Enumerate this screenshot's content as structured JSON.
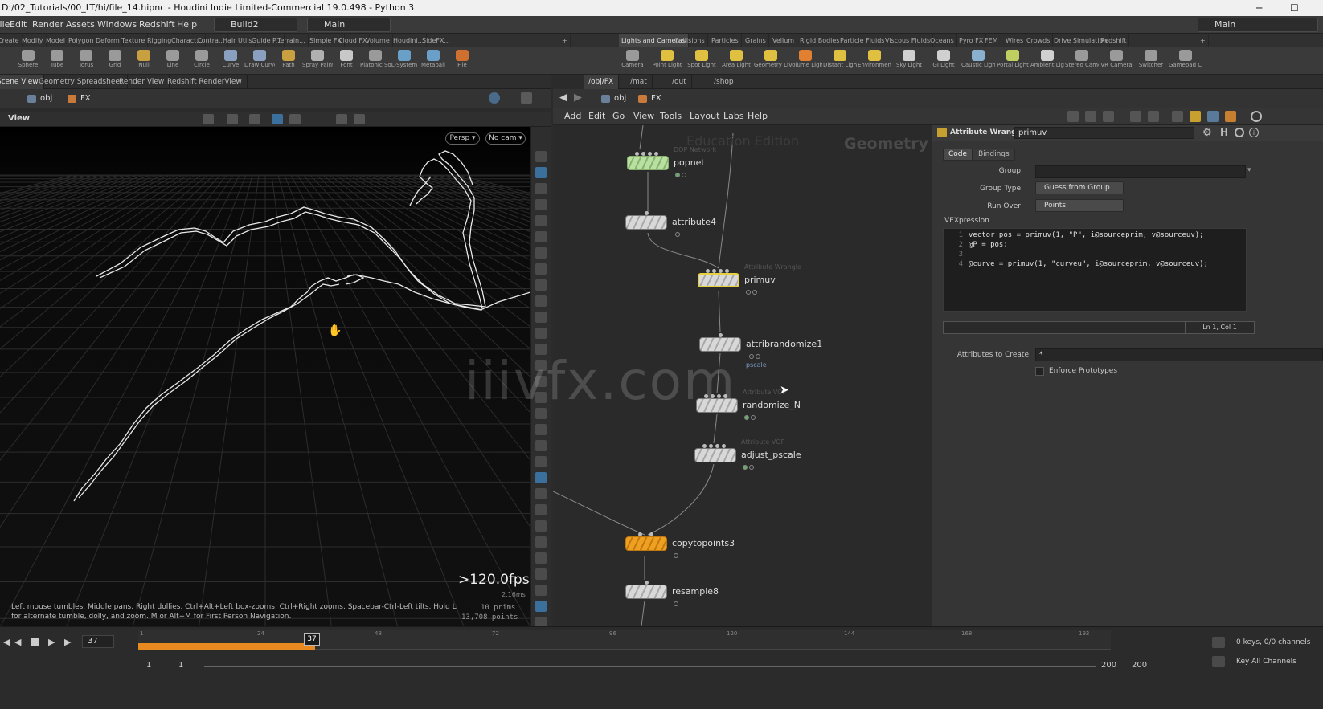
{
  "window": {
    "title": "D:/02_Tutorials/00_LT/hi/file_14.hipnc - Houdini Indie Limited-Commercial 19.0.498 - Python 3",
    "min": "─",
    "max": "☐"
  },
  "menubar": {
    "items": [
      "File",
      "Edit",
      "Render",
      "Assets",
      "Windows",
      "Redshift",
      "Help"
    ],
    "desktop1": "Build2",
    "desktop2": "Main",
    "right_desktop": "Main"
  },
  "shelf_tabs_left": [
    "Create",
    "Modify",
    "Model",
    "Polygon",
    "Deform",
    "Texture",
    "Rigging",
    "Charact...",
    "Contra...",
    "Hair Utils",
    "Guide P...",
    "Terrain...",
    "Simple FX",
    "Cloud FX",
    "Volume",
    "Houdini...",
    "SideFX..."
  ],
  "shelf_tabs_right": [
    "Lights and Cameras",
    "Collisions",
    "Particles",
    "Grains",
    "Vellum",
    "Rigid Bodies",
    "Particle Fluids",
    "Viscous Fluids",
    "Oceans",
    "Pyro FX",
    "FEM",
    "Wires",
    "Crowds",
    "Drive Simulation",
    "Redshift"
  ],
  "tools_left": [
    {
      "label": "Sphere",
      "color": "#9a9a9a"
    },
    {
      "label": "Tube",
      "color": "#9a9a9a"
    },
    {
      "label": "Torus",
      "color": "#9a9a9a"
    },
    {
      "label": "Grid",
      "color": "#9a9a9a"
    },
    {
      "label": "Null",
      "color": "#c8a040"
    },
    {
      "label": "Line",
      "color": "#9a9a9a"
    },
    {
      "label": "Circle",
      "color": "#9a9a9a"
    },
    {
      "label": "Curve",
      "color": "#8aa0c0"
    },
    {
      "label": "Draw Curve",
      "color": "#8aa0c0"
    },
    {
      "label": "Path",
      "color": "#c8a040"
    },
    {
      "label": "Spray Paint",
      "color": "#b0b0b0"
    },
    {
      "label": "Font",
      "color": "#c8c8c8"
    },
    {
      "label": "Platonic Solids",
      "color": "#9a9a9a"
    },
    {
      "label": "L-System",
      "color": "#6aa0c8"
    },
    {
      "label": "Metaball",
      "color": "#6aa0c8"
    },
    {
      "label": "File",
      "color": "#d07030"
    }
  ],
  "tools_right": [
    {
      "label": "Camera",
      "color": "#9a9a9a"
    },
    {
      "label": "Point Light",
      "color": "#e0c040"
    },
    {
      "label": "Spot Light",
      "color": "#e0c040"
    },
    {
      "label": "Area Light",
      "color": "#e0c040"
    },
    {
      "label": "Geometry Light",
      "color": "#e0c040"
    },
    {
      "label": "Volume Light",
      "color": "#e08030"
    },
    {
      "label": "Distant Light",
      "color": "#e0c040"
    },
    {
      "label": "Environment Light",
      "color": "#e0c040"
    },
    {
      "label": "Sky Light",
      "color": "#d0d0d0"
    },
    {
      "label": "GI Light",
      "color": "#d0d0d0"
    },
    {
      "label": "Caustic Light",
      "color": "#8ab0d0"
    },
    {
      "label": "Portal Light",
      "color": "#c0d060"
    },
    {
      "label": "Ambient Light",
      "color": "#d0d0d0"
    },
    {
      "label": "Stereo Camera",
      "color": "#9a9a9a"
    },
    {
      "label": "VR Camera",
      "color": "#9a9a9a"
    },
    {
      "label": "Switcher",
      "color": "#9a9a9a"
    },
    {
      "label": "Gamepad Camera",
      "color": "#9a9a9a"
    }
  ],
  "left_pane": {
    "tabs": [
      "Scene View",
      "Geometry Spreadsheet",
      "Render View",
      "Redshift RenderView"
    ],
    "path": [
      "obj",
      "FX"
    ],
    "view_label": "View",
    "persp": "Persp ▾",
    "cam": "No cam ▾",
    "fps": ">120.0fps",
    "ms": "2.16ms",
    "prims": "10  prims",
    "points": "13,708 points",
    "help": "Left mouse tumbles. Middle pans. Right dollies. Ctrl+Alt+Left box-zooms. Ctrl+Right zooms. Spacebar-Ctrl-Left tilts. Hold L for alternate tumble, dolly, and zoom.    M or Alt+M for First Person Navigation."
  },
  "right_pane": {
    "tabs": [
      "/obj/FX",
      "/mat",
      "/out",
      "/shop"
    ],
    "path": [
      "obj",
      "FX"
    ],
    "menu": [
      "Add",
      "Edit",
      "Go",
      "View",
      "Tools",
      "Layout",
      "Labs",
      "Help"
    ],
    "edition": "Education Edition",
    "context": "Geometry"
  },
  "nodes": [
    {
      "name": "popnet",
      "type": "DOP Network",
      "tag": ""
    },
    {
      "name": "attribute4",
      "type": "",
      "tag": ""
    },
    {
      "name": "primuv",
      "type": "Attribute Wrangle",
      "tag": ""
    },
    {
      "name": "attribrandomize1",
      "type": "",
      "tag": "pscale"
    },
    {
      "name": "randomize_N",
      "type": "Attribute VOP",
      "tag": ""
    },
    {
      "name": "adjust_pscale",
      "type": "Attribute VOP",
      "tag": ""
    },
    {
      "name": "copytopoints3",
      "type": "",
      "tag": ""
    },
    {
      "name": "resample8",
      "type": "",
      "tag": ""
    }
  ],
  "params": {
    "node_type": "Attribute Wrangle",
    "node_name": "primuv",
    "tabs": [
      "Code",
      "Bindings"
    ],
    "group_label": "Group",
    "group_value": "",
    "group_type_label": "Group Type",
    "group_type_value": "Guess from Group",
    "run_over_label": "Run Over",
    "run_over_value": "Points",
    "vex_label": "VEXpression",
    "code": [
      "vector pos = primuv(1, \"P\", i@sourceprim, v@sourceuv);",
      "@P = pos;",
      "",
      "@curve = primuv(1, \"curveu\", i@sourceprim, v@sourceuv);"
    ],
    "cursor": "Ln 1, Col 1",
    "attrs_label": "Attributes to Create",
    "attrs_value": "*",
    "enforce_label": "Enforce Prototypes"
  },
  "timeline": {
    "frame": "37",
    "ticks": [
      "1",
      "24",
      "48",
      "72",
      "96",
      "120",
      "144",
      "168",
      "192"
    ],
    "current": "37",
    "start": "1",
    "start2": "1",
    "end": "200",
    "end2": "200",
    "keys": "0 keys, 0/0 channels",
    "key_all": "Key All Channels"
  },
  "watermark": "iiivfx.com"
}
